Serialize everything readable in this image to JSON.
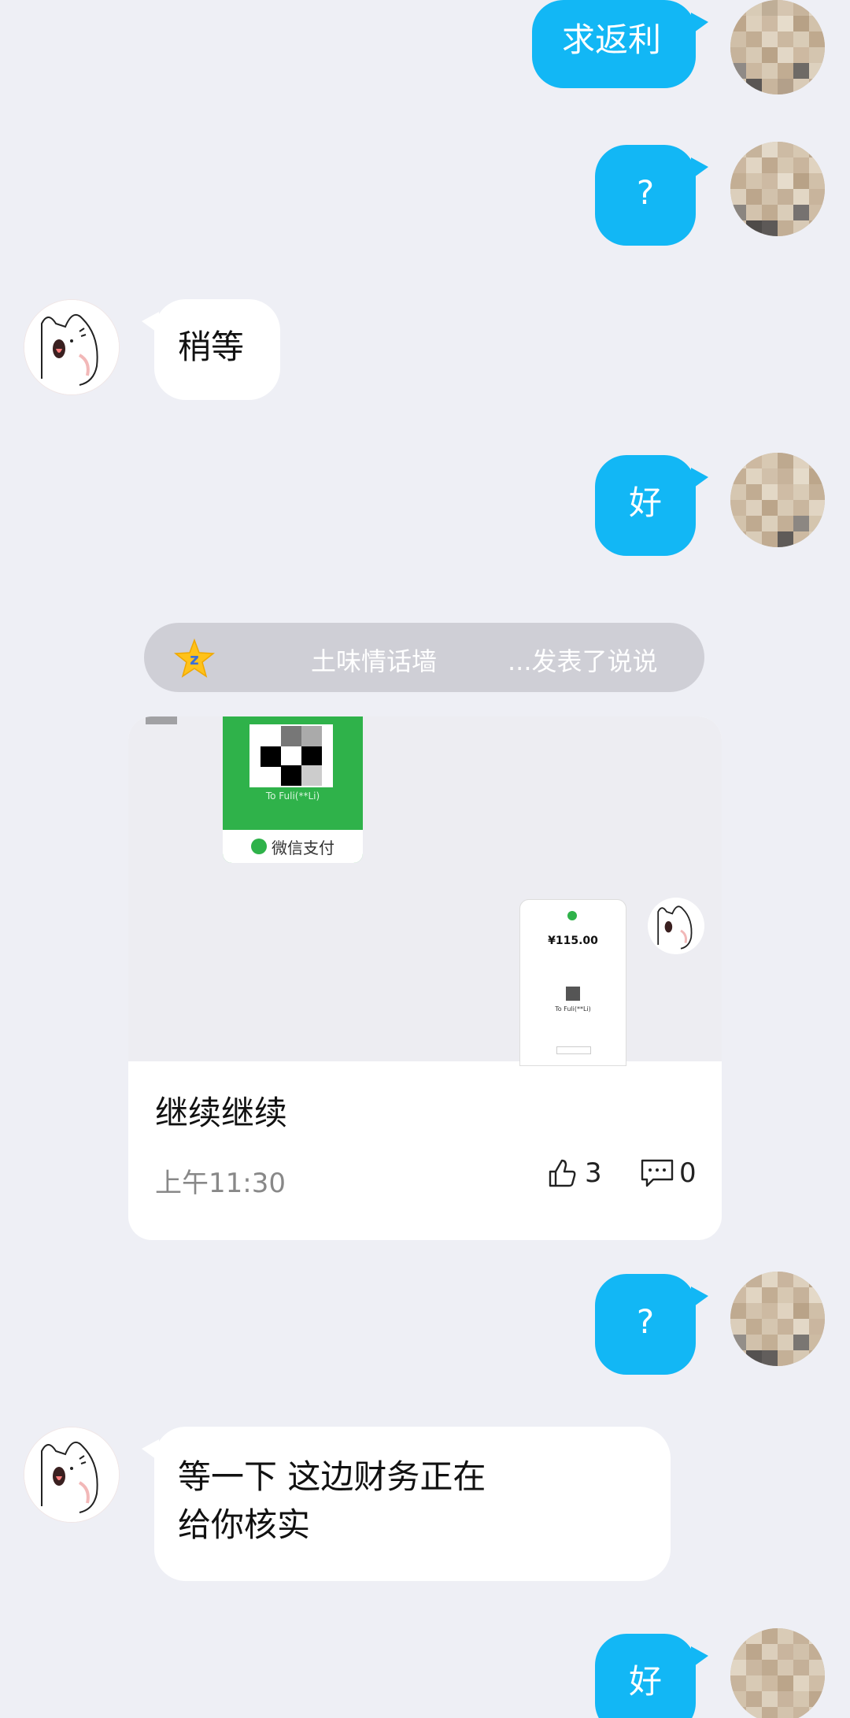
{
  "messages": [
    {
      "side": "out",
      "text": "求返利"
    },
    {
      "side": "out",
      "text": "?"
    },
    {
      "side": "in",
      "text": "稍等"
    },
    {
      "side": "out",
      "text": "好"
    },
    {
      "side": "out",
      "text": "?"
    },
    {
      "side": "in",
      "lines": [
        "等一下 这边财务正在",
        "给你核实"
      ]
    },
    {
      "side": "out",
      "text": "好"
    }
  ],
  "qzone": {
    "icon": "qzone-star-icon",
    "title": "土味情话墙",
    "action": "...发表了说说"
  },
  "card": {
    "image": {
      "pay_footer": "微信支付",
      "pay_to": "To Fuli(**Li)",
      "amount": "¥115.00",
      "phone_label": "To Fuli(**Li)"
    },
    "text": "继续继续",
    "time": "上午11:30",
    "likes": "3",
    "comments": "0"
  },
  "colors": {
    "bubble_out": "#12b7f5",
    "bubble_in": "#ffffff",
    "background": "#eeeff5"
  }
}
